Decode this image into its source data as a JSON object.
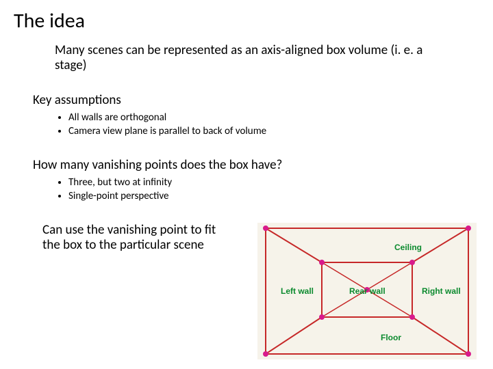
{
  "title": "The idea",
  "intro": "Many scenes can be represented as an axis-aligned box volume (i. e. a stage)",
  "assumptions_heading": "Key assumptions",
  "assumptions": {
    "b1": "All walls are orthogonal",
    "b2": "Camera view plane is parallel to back of volume"
  },
  "question": "How many vanishing points does the box have?",
  "answers": {
    "b1": "Three, but two at infinity",
    "b2": "Single-point perspective"
  },
  "final": "Can use the vanishing point to fit the box to the particular scene",
  "diagram": {
    "ceiling": "Ceiling",
    "leftwall": "Left wall",
    "rearwall": "Rear wall",
    "rightwall": "Right wall",
    "floor": "Floor"
  }
}
